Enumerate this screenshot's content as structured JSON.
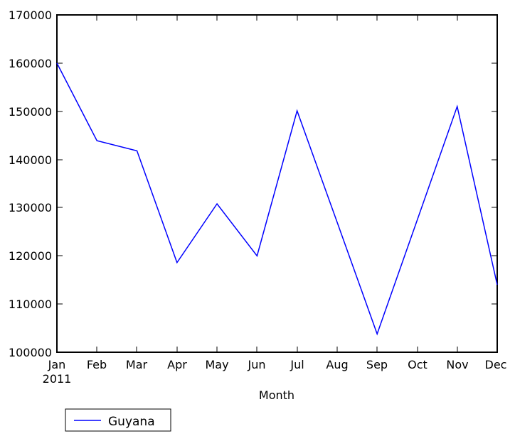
{
  "chart_data": {
    "type": "line",
    "title": "",
    "xlabel": "Month",
    "ylabel": "",
    "categories": [
      "Jan",
      "Feb",
      "Mar",
      "Apr",
      "May",
      "Jun",
      "Jul",
      "Aug",
      "Sep",
      "Oct",
      "Nov",
      "Dec"
    ],
    "x_year_label": "2011",
    "series": [
      {
        "name": "Guyana",
        "color": "#0000ff",
        "values": [
          160000,
          143900,
          141800,
          118600,
          130800,
          120000,
          150100,
          127000,
          103800,
          127400,
          151000,
          114000
        ]
      }
    ],
    "ylim": [
      100000,
      170000
    ],
    "yticks": [
      100000,
      110000,
      120000,
      130000,
      140000,
      150000,
      160000,
      170000
    ],
    "ytick_labels": [
      "100000",
      "110000",
      "120000",
      "130000",
      "140000",
      "150000",
      "160000",
      "170000"
    ],
    "xtick_labels": [
      "Jan",
      "Feb",
      "Mar",
      "Apr",
      "May",
      "Jun",
      "Jul",
      "Aug",
      "Sep",
      "Oct",
      "Nov",
      "Dec"
    ],
    "grid": false,
    "legend_position": "below-left",
    "legend_entries": [
      {
        "label": "Guyana",
        "color": "#0000ff"
      }
    ]
  },
  "figure": {
    "background_color": "#ffffff",
    "axes_color": "#000000"
  }
}
